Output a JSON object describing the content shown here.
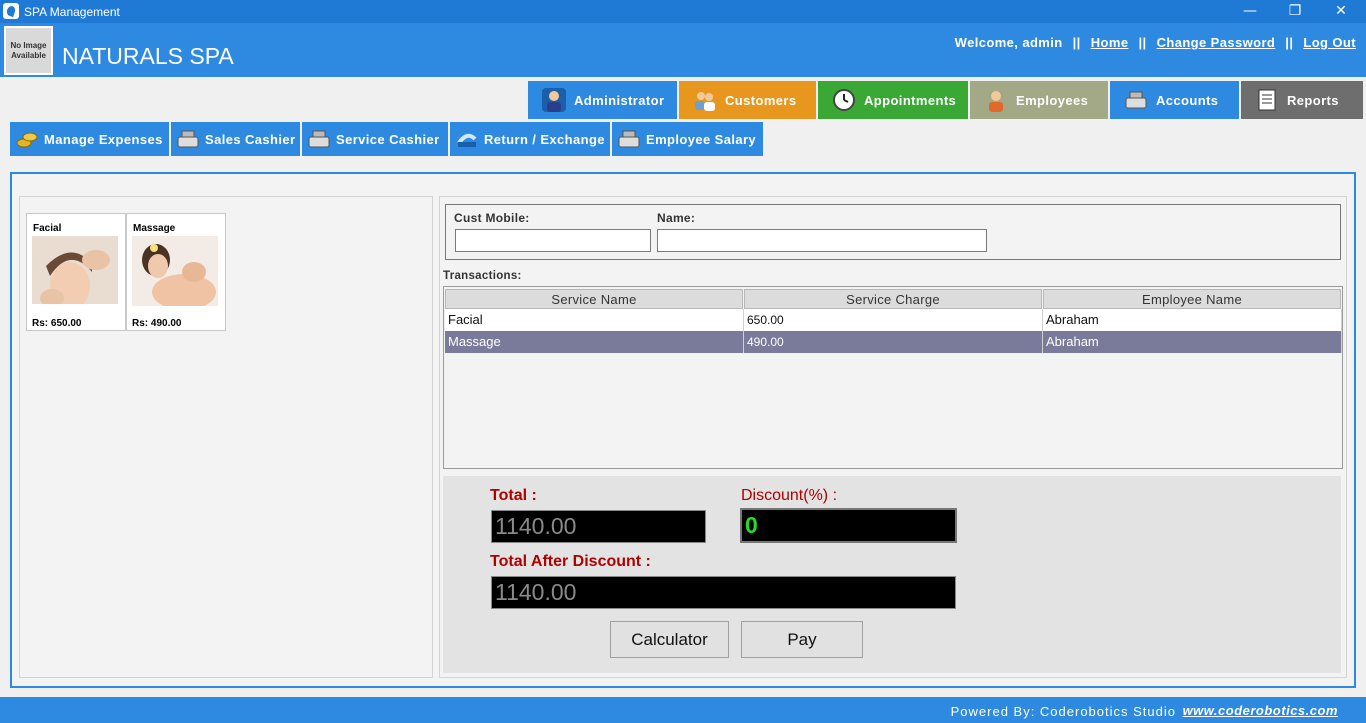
{
  "window": {
    "title": "SPA Management",
    "minimize": "—",
    "maximize": "❐",
    "close": "✕"
  },
  "header": {
    "logo_text_line1": "No Image",
    "logo_text_line2": "Available",
    "brand": "NATURALS SPA",
    "welcome": "Welcome, admin",
    "sep": "||",
    "home": "Home",
    "change_password": "Change Password",
    "logout": "Log Out"
  },
  "main_tabs": [
    {
      "label": "Administrator",
      "color": "#2d8ae0",
      "icon": "admin-icon"
    },
    {
      "label": "Customers",
      "color": "#e8971e",
      "icon": "customers-icon"
    },
    {
      "label": "Appointments",
      "color": "#3aa835",
      "icon": "clock-icon"
    },
    {
      "label": "Employees",
      "color": "#a3a886",
      "icon": "employees-icon"
    },
    {
      "label": "Accounts",
      "color": "#2d8ae0",
      "icon": "cash-register-icon"
    },
    {
      "label": "Reports",
      "color": "#6e6e6e",
      "icon": "report-icon"
    }
  ],
  "sub_tabs": [
    {
      "label": "Manage Expenses",
      "icon": "coins-icon"
    },
    {
      "label": "Sales Cashier",
      "icon": "cash-register-icon"
    },
    {
      "label": "Service Cashier",
      "icon": "cash-register-icon"
    },
    {
      "label": "Return / Exchange",
      "icon": "return-icon"
    },
    {
      "label": "Employee Salary",
      "icon": "cash-register-icon"
    }
  ],
  "services": [
    {
      "name": "Facial",
      "price": "Rs:  650.00"
    },
    {
      "name": "Massage",
      "price": "Rs:  490.00"
    }
  ],
  "customer": {
    "mobile_label": "Cust Mobile:",
    "mobile_value": "",
    "name_label": "Name:",
    "name_value": ""
  },
  "transactions": {
    "label": "Transactions:",
    "columns": [
      "Service Name",
      "Service Charge",
      "Employee Name"
    ],
    "rows": [
      [
        "Facial",
        "650.00",
        "Abraham"
      ],
      [
        "Massage",
        "490.00",
        "Abraham"
      ]
    ],
    "selected_row": 1
  },
  "payment": {
    "total_label": "Total :",
    "total_value": "1140.00",
    "discount_label": "Discount(%) :",
    "discount_value": "0",
    "after_label": "Total After Discount :",
    "after_value": "1140.00",
    "calculator": "Calculator",
    "pay": "Pay"
  },
  "footer": {
    "powered": "Powered By: Coderobotics Studio",
    "website": "www.coderobotics.com"
  }
}
